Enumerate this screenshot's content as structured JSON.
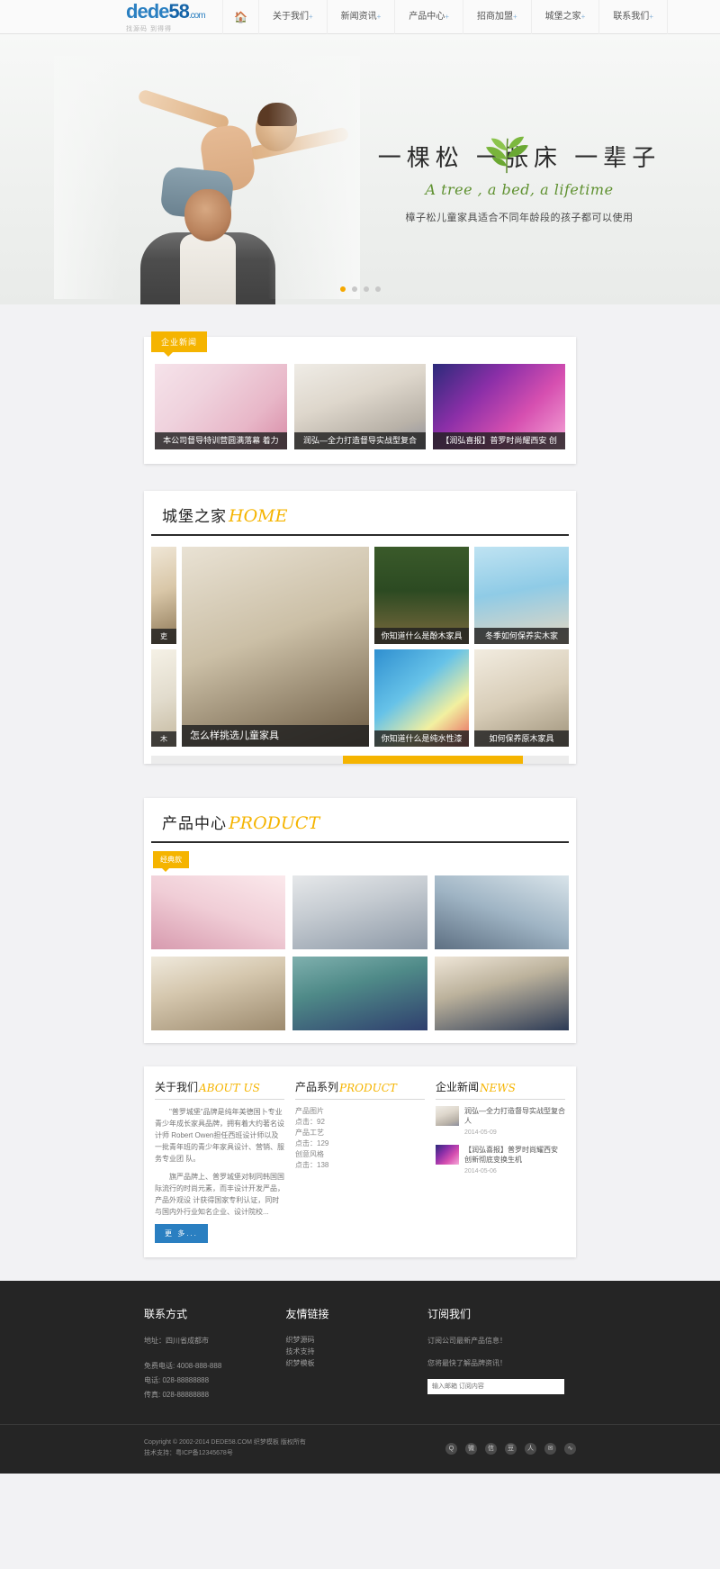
{
  "header": {
    "logo": {
      "d1": "de",
      "d2": "de",
      "num": "58",
      "com": ".com",
      "sub": "找源码  到得得"
    },
    "home_icon": "home-icon",
    "nav": [
      {
        "label": "关于我们",
        "plus": "+"
      },
      {
        "label": "新闻资讯",
        "plus": "+"
      },
      {
        "label": "产品中心",
        "plus": "+"
      },
      {
        "label": "招商加盟",
        "plus": "+"
      },
      {
        "label": "城堡之家",
        "plus": "+"
      },
      {
        "label": "联系我们",
        "plus": "+"
      }
    ]
  },
  "banner": {
    "headline": "一棵松  一张床  一辈子",
    "subline": "A tree , a bed, a lifetime",
    "desc": "樟子松儿童家具适合不同年龄段的孩子都可以使用",
    "dots": [
      "1",
      "2",
      "3",
      "4"
    ],
    "active_dot": 0,
    "accent": "#f5a800"
  },
  "cases": {
    "badge": "企业新闻",
    "items": [
      {
        "caption": "本公司督导特训营圆满落幕 着力",
        "photo": "p1"
      },
      {
        "caption": "润弘—全力打造督导实战型复合",
        "photo": "p2"
      },
      {
        "caption": "【润弘喜报】普罗时尚耀西安 创",
        "photo": "p3"
      }
    ]
  },
  "home": {
    "title_cn": "城堡之家",
    "title_en": "HOME",
    "left_strip": [
      {
        "caption": "吏",
        "photo": "p6"
      },
      {
        "caption": "木",
        "photo": "p8"
      }
    ],
    "feature": {
      "caption": "怎么样挑选儿童家具",
      "photo": "p9"
    },
    "grid": [
      {
        "caption": "你知道什么是酚木家具",
        "photo": "p4"
      },
      {
        "caption": "冬季如何保养实木家",
        "photo": "p5"
      },
      {
        "caption": "你知道什么是纯水性漆",
        "photo": "p7"
      },
      {
        "caption": "如何保养原木家具",
        "photo": "p16"
      }
    ],
    "scroll_position": "46%",
    "scroll_width": "43%"
  },
  "product": {
    "title_cn": "产品中心",
    "title_en": "PRODUCT",
    "badge": "经典款",
    "items": [
      {
        "photo": "p17"
      },
      {
        "photo": "p11"
      },
      {
        "photo": "p18"
      },
      {
        "photo": "p10"
      },
      {
        "photo": "p14"
      },
      {
        "photo": "p15"
      }
    ]
  },
  "info": {
    "about": {
      "title_cn": "关于我们",
      "title_en": "ABOUT US",
      "paragraphs": [
        "\"普罗城堡\"品牌是纯年美德国卜专业青少年成长家具品牌，拥有着大约著名设计师 Robert Owen担任西班设计师以及一批青年班的青少年家具设计、营销、服务专业团 队。",
        "旗严品牌上、普罗城堡对制同韩国国际流行的时尚元素，而丰设计开发严品，产品外观设 计获得国家专利认证，同时与国内外行业知名企业、设计院校..."
      ],
      "more_label": "更  多..."
    },
    "series": {
      "title_cn": "产品系列",
      "title_en": "PRODUCT",
      "items": [
        {
          "label": "产品图片",
          "count": "点击：92"
        },
        {
          "label": "产品工艺",
          "count": "点击：129"
        },
        {
          "label": "创意风格",
          "count": "点击：138"
        }
      ]
    },
    "news": {
      "title_cn": "企业新闻",
      "title_en": "NEWS",
      "items": [
        {
          "title": "润弘—全力打造督导实战型复合人",
          "date": "2014-05-09",
          "photo": "p2"
        },
        {
          "title": "【润弘喜报】普罗时尚耀西安 创新彻底变换生机",
          "date": "2014-05-06",
          "photo": "p3"
        }
      ]
    }
  },
  "footer": {
    "contact": {
      "title": "联系方式",
      "lines": [
        "地址：四川省成都市",
        "免费电话: 4008-888-888",
        "电话: 028-88888888",
        "传真: 028-88888888"
      ]
    },
    "links": {
      "title": "友情链接",
      "items": [
        "织梦源码",
        "技术支持",
        "织梦模板"
      ]
    },
    "subscribe": {
      "title": "订阅我们",
      "line1": "订阅公司最新产品信息！",
      "line2": "您将最快了解品牌资讯！",
      "placeholder": "输入邮箱 订阅内容"
    },
    "copyright": "Copyright © 2002-2014 DEDE58.COM 织梦模板 版权所有",
    "icp": "技术支持：粤ICP备12345678号",
    "social": [
      "qq-icon",
      "weibo-icon",
      "weixin-icon",
      "douban-icon",
      "renren-icon",
      "mail-icon",
      "rss-icon"
    ]
  }
}
